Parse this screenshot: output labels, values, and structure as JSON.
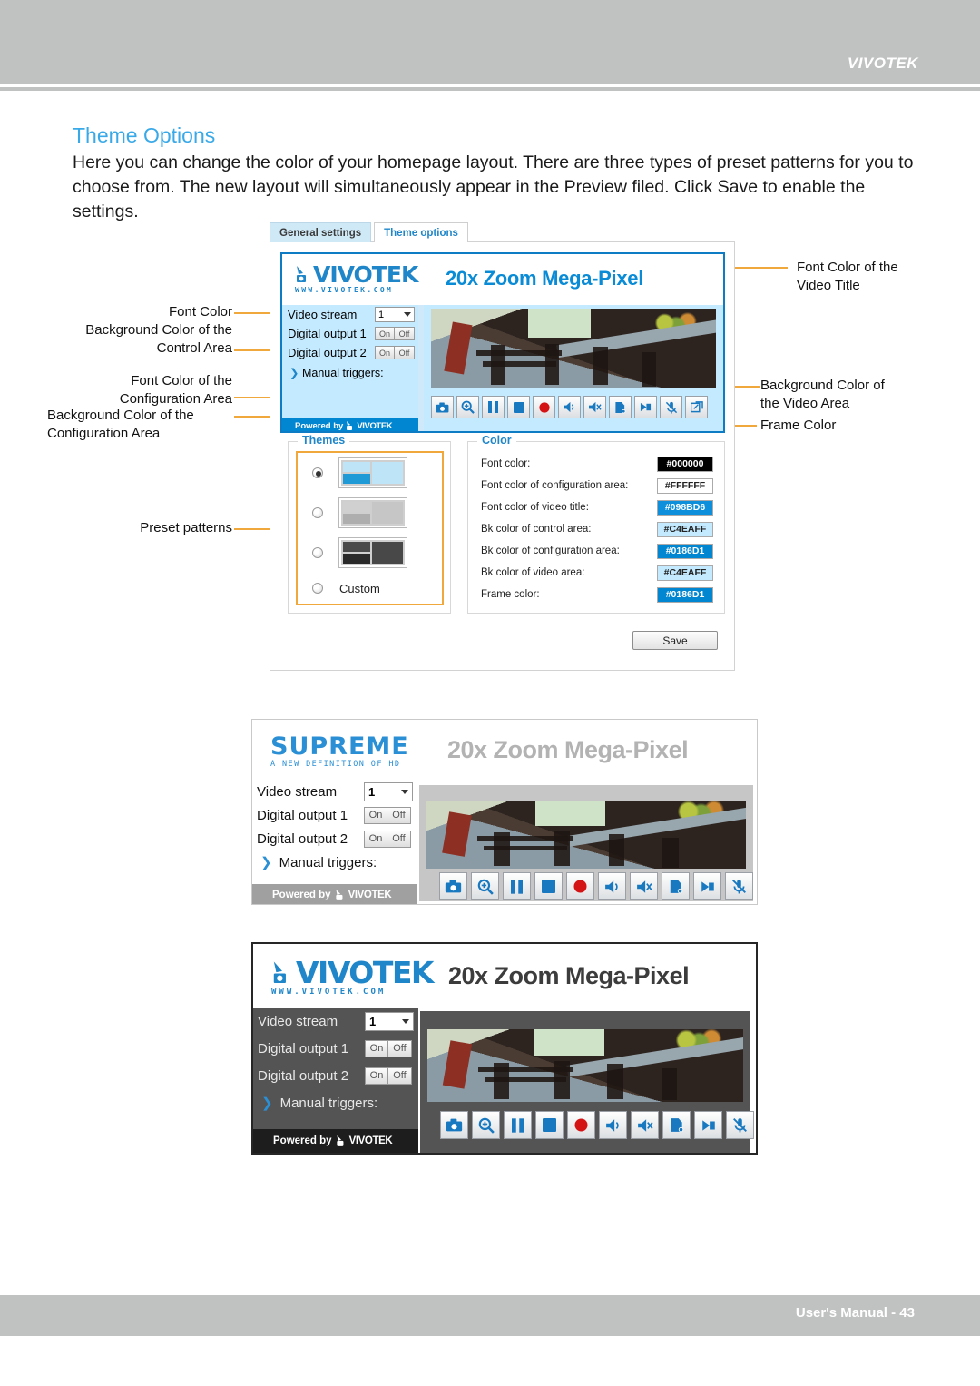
{
  "header": {
    "brand": "VIVOTEK"
  },
  "footer": {
    "text": "User's Manual - 43"
  },
  "section": {
    "title": "Theme Options",
    "body": "Here you can change the color of your homepage layout. There are three types of preset patterns for you to choose from. The new layout will simultaneously appear in the Preview filed. Click  Save to enable the settings."
  },
  "annotations": {
    "left": [
      {
        "id": "font-color",
        "text": "Font Color"
      },
      {
        "id": "bg-control-area",
        "text": "Background Color of the\nControl Area"
      },
      {
        "id": "font-config-area",
        "text": "Font Color of the\nConfiguration Area"
      },
      {
        "id": "bg-config-area",
        "text": "Background Color of the\nConfiguration Area"
      },
      {
        "id": "preset-patterns",
        "text": "Preset patterns"
      }
    ],
    "right": [
      {
        "id": "font-video-title",
        "text": "Font Color of the\nVideo Title"
      },
      {
        "id": "bg-video-area",
        "text": "Background Color of\nthe Video Area"
      },
      {
        "id": "frame-color",
        "text": "Frame Color"
      }
    ]
  },
  "tabs": [
    {
      "label": "General settings",
      "active": false
    },
    {
      "label": "Theme options",
      "active": true
    }
  ],
  "preview": {
    "logo_word": "VIVOTEK",
    "logo_sub": "WWW.VIVOTEK.COM",
    "video_title": "20x Zoom Mega-Pixel",
    "controls": {
      "video_stream_label": "Video stream",
      "video_stream_value": "1",
      "digital_output_1_label": "Digital output 1",
      "digital_output_2_label": "Digital output 2",
      "on_label": "On",
      "off_label": "Off",
      "manual_triggers_label": "Manual triggers:",
      "powered_by": "Powered by",
      "powered_brand": "VIVOTEK"
    },
    "icons": [
      "snapshot-icon",
      "digital-zoom-icon",
      "pause-icon",
      "stop-icon",
      "record-icon",
      "volume-on-icon",
      "mute-icon",
      "speaker-icon",
      "talk-icon",
      "mic-mute-icon",
      "fullscreen-icon"
    ],
    "theme_colors": {
      "header_bg": "#ffffff",
      "title_color": "#098BD6",
      "control_bg": "#C4EAFF",
      "control_font": "#000000",
      "video_bg": "#C4EAFF",
      "frame": "#0186D1",
      "powered_bg": "#0186D1",
      "powered_font": "#FFFFFF"
    }
  },
  "themes_panel": {
    "legend": "Themes",
    "options": [
      {
        "id": "preset-blue",
        "selected": true,
        "left_top": "#BEE4F7",
        "left_bottom": "#1F9AD6",
        "right": "#BEE4F7",
        "border": "#ffffff"
      },
      {
        "id": "preset-gray",
        "selected": false,
        "left_top": "#D0D0D0",
        "left_bottom": "#AEAEAE",
        "right": "#C6C6C6",
        "border": "#ffffff"
      },
      {
        "id": "preset-dark",
        "selected": false,
        "left_top": "#4A4A4A",
        "left_bottom": "#2A2A2A",
        "right": "#484848",
        "border": "#ffffff"
      },
      {
        "id": "custom",
        "selected": false,
        "label": "Custom"
      }
    ]
  },
  "color_panel": {
    "legend": "Color",
    "rows": [
      {
        "label": "Font color:",
        "value": "#000000",
        "bg": "#000000",
        "fg": "#ffffff"
      },
      {
        "label": "Font color of configuration area:",
        "value": "#FFFFFF",
        "bg": "#FFFFFF",
        "fg": "#222222"
      },
      {
        "label": "Font color of video title:",
        "value": "#098BD6",
        "bg": "#0d8fdb",
        "fg": "#ffffff"
      },
      {
        "label": "Bk color of control area:",
        "value": "#C4EAFF",
        "bg": "#c4eaff",
        "fg": "#222222"
      },
      {
        "label": "Bk color of configuration area:",
        "value": "#0186D1",
        "bg": "#0186d1",
        "fg": "#ffffff"
      },
      {
        "label": "Bk color of video area:",
        "value": "#C4EAFF",
        "bg": "#c4eaff",
        "fg": "#222222"
      },
      {
        "label": "Frame color:",
        "value": "#0186D1",
        "bg": "#0186d1",
        "fg": "#ffffff"
      }
    ]
  },
  "save_button": {
    "label": "Save"
  },
  "preview_supreme": {
    "logo_word": "SUPREME",
    "logo_sub": "A NEW DEFINITION OF HD",
    "video_title": "20x Zoom Mega-Pixel",
    "controls": {
      "video_stream_label": "Video stream",
      "video_stream_value": "1",
      "digital_output_1_label": "Digital output 1",
      "digital_output_2_label": "Digital output 2",
      "on_label": "On",
      "off_label": "Off",
      "manual_triggers_label": "Manual triggers:",
      "powered_by": "Powered by",
      "powered_brand": "VIVOTEK"
    },
    "theme_colors": {
      "header_bg": "#ffffff",
      "title_color": "#b3b3b3",
      "control_bg": "#ffffff",
      "control_font": "#111111",
      "video_bg": "#c6c6c6",
      "powered_bg": "#a0a0a0",
      "powered_font": "#ffffff"
    }
  },
  "preview_dark": {
    "logo_word": "VIVOTEK",
    "logo_sub": "WWW.VIVOTEK.COM",
    "video_title": "20x Zoom Mega-Pixel",
    "controls": {
      "video_stream_label": "Video stream",
      "video_stream_value": "1",
      "digital_output_1_label": "Digital output 1",
      "digital_output_2_label": "Digital output 2",
      "on_label": "On",
      "off_label": "Off",
      "manual_triggers_label": "Manual triggers:",
      "powered_by": "Powered by",
      "powered_brand": "VIVOTEK"
    },
    "theme_colors": {
      "header_bg": "#ffffff",
      "title_color": "#3c3c3c",
      "control_bg": "#545454",
      "control_font": "#e8e8e8",
      "video_bg": "#545454",
      "frame": "#262626",
      "powered_bg": "#1d1d1d",
      "powered_font": "#ffffff"
    }
  }
}
